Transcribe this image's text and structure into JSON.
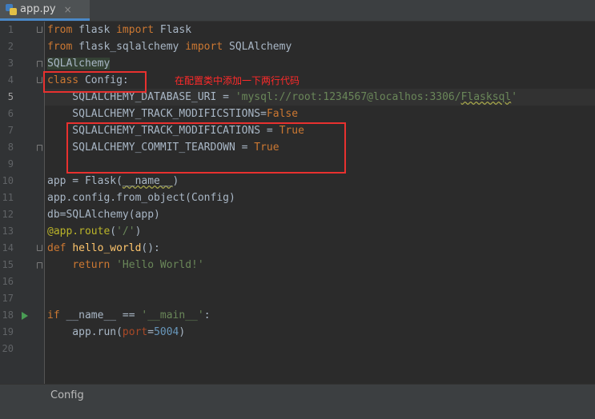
{
  "tab": {
    "file_name": "app.py",
    "close_glyph": "×",
    "icon": "python-file-icon"
  },
  "annotation": {
    "note": "在配置类中添加一下两行代码",
    "color": "#e8312f"
  },
  "breadcrumb": {
    "label": "Config"
  },
  "gutter": {
    "line_numbers": [
      "1",
      "2",
      "3",
      "4",
      "5",
      "6",
      "7",
      "8",
      "9",
      "10",
      "11",
      "12",
      "13",
      "14",
      "15",
      "16",
      "17",
      "18",
      "19",
      "20"
    ],
    "current_line": "5",
    "run_icon_line": "18"
  },
  "code": {
    "l1": {
      "k1": "from",
      "t1": " flask ",
      "k2": "import",
      "t2": " Flask"
    },
    "l2": {
      "k1": "from",
      "t1": " flask_sqlalchemy ",
      "k2": "import",
      "t2": " SQLAlchemy"
    },
    "l3": {
      "t1": "SQLAlchemy"
    },
    "l4": {
      "k1": "class",
      "t1": " Config:"
    },
    "l5": {
      "t1": "    SQLALCHEMY_DATABASE_URI = ",
      "s1": "'mysql://root:1234567@localhos:3306/",
      "s2": "Flasksql",
      "s3": "'"
    },
    "l6": {
      "t1": "    SQLALCHEMY_TRACK_MODIFICSTIONS=",
      "k1": "False"
    },
    "l7": {
      "t1": "    SQLALCHEMY_TRACK_MODIFICATIONS = ",
      "k1": "True"
    },
    "l8": {
      "t1": "    SQLALCHEMY_COMMIT_TEARDOWN = ",
      "k1": "True"
    },
    "l10": {
      "t1": "app = Flask(",
      "t2": "__name__",
      "t3": ")"
    },
    "l11": {
      "t1": "app.config.from_object(Config)"
    },
    "l12": {
      "t1": "db=SQLAlchemy(app)"
    },
    "l13": {
      "d1": "@app.route",
      "t1": "(",
      "s1": "'/'",
      "t2": ")"
    },
    "l14": {
      "k1": "def",
      "t1": " ",
      "f1": "hello_world",
      "t2": "():"
    },
    "l15": {
      "t1": "    ",
      "k1": "return",
      "t2": " ",
      "s1": "'Hello World!'"
    },
    "l18": {
      "k1": "if",
      "t1": " __name__ == ",
      "s1": "'__main__'",
      "t2": ":"
    },
    "l19": {
      "t1": "    app.run(",
      "p1": "port",
      "t2": "=",
      "n1": "5004",
      "t3": ")"
    }
  }
}
